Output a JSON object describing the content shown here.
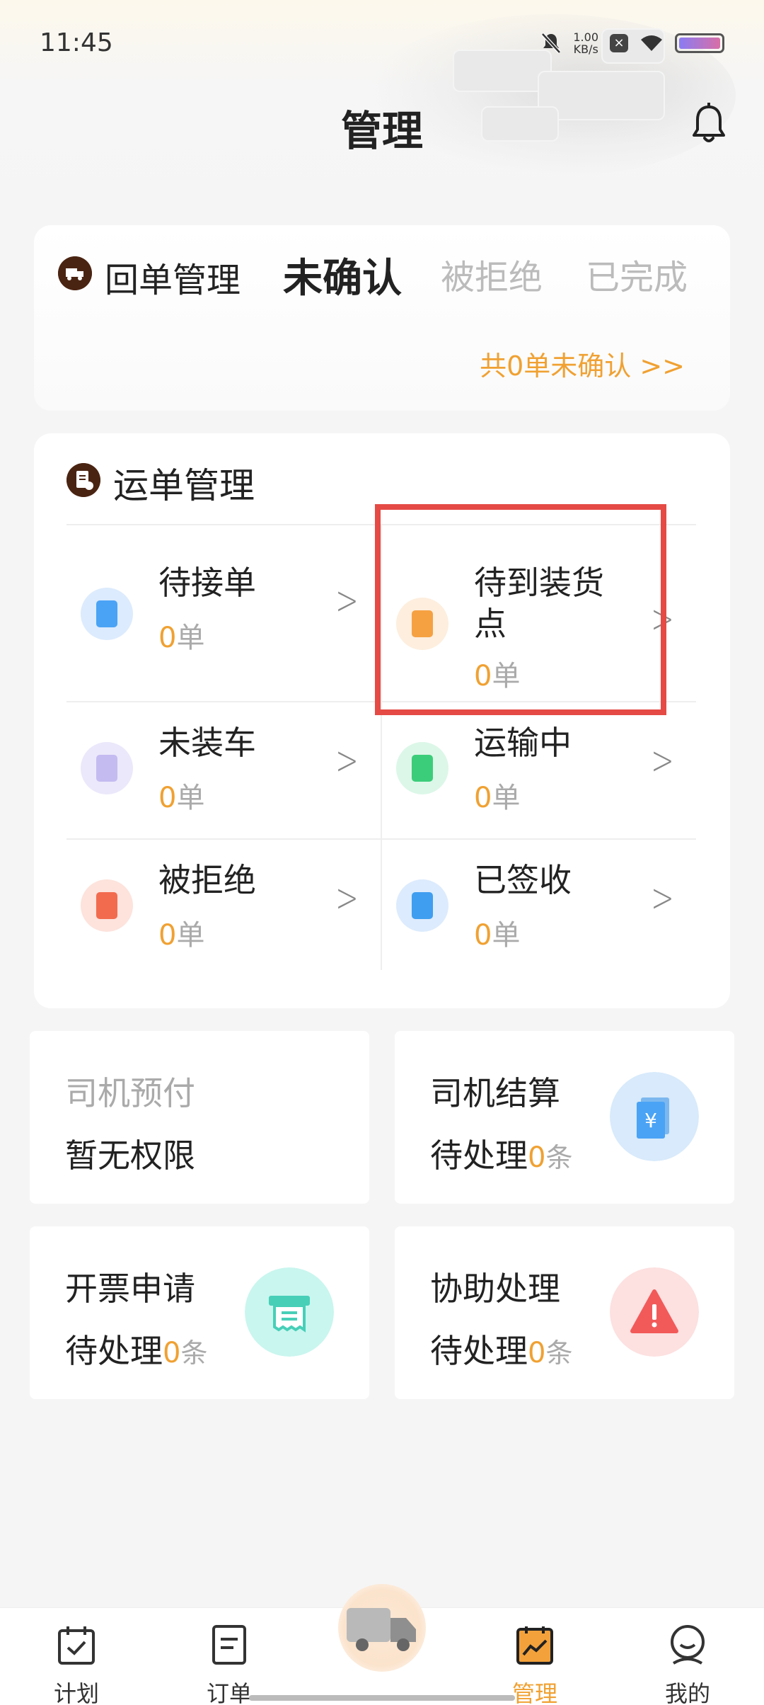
{
  "status_bar": {
    "time": "11:45",
    "net_speed_value": "1.00",
    "net_speed_unit": "KB/s",
    "icons": [
      "mute-bell-icon",
      "close-notification-icon",
      "wifi-icon",
      "battery-icon"
    ]
  },
  "header": {
    "title": "管理",
    "notification_icon": "bell-icon"
  },
  "receipt": {
    "title": "回单管理",
    "tabs": [
      "未确认",
      "被拒绝",
      "已完成"
    ],
    "active_tab": "未确认",
    "summary": "共0单未确认 >>"
  },
  "waybill": {
    "title": "运单管理",
    "items": [
      {
        "label": "待接单",
        "count": "0",
        "unit": "单",
        "icon": "clipboard-clock-icon",
        "color": "#4aa3f5"
      },
      {
        "label": "待到装货点",
        "count": "0",
        "unit": "单",
        "icon": "clipboard-location-icon",
        "color": "#f5a142"
      },
      {
        "label": "未装车",
        "count": "0",
        "unit": "单",
        "icon": "clipboard-alert-icon",
        "color": "#a79ae8"
      },
      {
        "label": "运输中",
        "count": "0",
        "unit": "单",
        "icon": "clipboard-truck-icon",
        "color": "#3ccd7a"
      },
      {
        "label": "被拒绝",
        "count": "0",
        "unit": "单",
        "icon": "clipboard-x-icon",
        "color": "#f26b4f"
      },
      {
        "label": "已签收",
        "count": "0",
        "unit": "单",
        "icon": "clipboard-check-icon",
        "color": "#3f9ef0"
      }
    ]
  },
  "cards": {
    "prepay": {
      "title": "司机预付",
      "status": "暂无权限"
    },
    "settlement": {
      "title": "司机结算",
      "status": "待处理",
      "count": "0",
      "unit": "条",
      "icon": "yen-document-icon"
    },
    "invoice": {
      "title": "开票申请",
      "status": "待处理",
      "count": "0",
      "unit": "条",
      "icon": "invoice-printer-icon"
    },
    "assist": {
      "title": "协助处理",
      "status": "待处理",
      "count": "0",
      "unit": "条",
      "icon": "warning-icon"
    }
  },
  "nav": {
    "items": [
      "计划",
      "订单",
      "管理",
      "我的"
    ],
    "active": "管理",
    "center_icon": "truck-icon"
  },
  "colors": {
    "accent": "#f0a132",
    "highlight_border": "#e54a45",
    "brand_dark": "#4a2412"
  }
}
